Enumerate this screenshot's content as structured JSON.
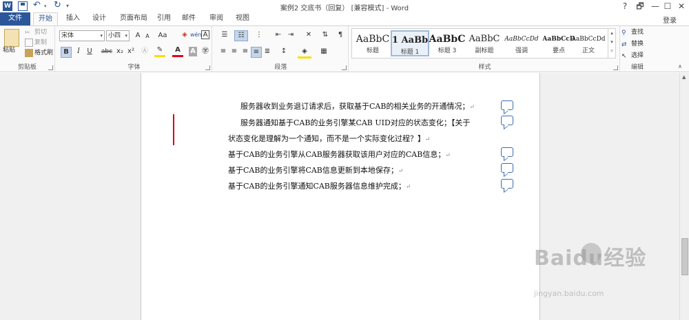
{
  "window": {
    "title": "案例2 交底书（回复） [兼容模式] - Word",
    "login": "登录",
    "logo": "W",
    "help": "?",
    "controls": [
      "🗗",
      "—",
      "☐",
      "✕"
    ]
  },
  "tabs": {
    "file": "文件",
    "items": [
      "开始",
      "插入",
      "设计",
      "页面布局",
      "引用",
      "邮件",
      "审阅",
      "视图"
    ],
    "active": "开始"
  },
  "ribbon": {
    "clipboard": {
      "label": "剪贴板",
      "paste": "粘贴",
      "cut": "剪切",
      "copy": "复制",
      "format_painter": "格式刷"
    },
    "font": {
      "label": "字体",
      "font_name": "宋体",
      "font_size": "小四",
      "grow": "A",
      "shrink": "A",
      "case": "Aa",
      "bold": "B",
      "italic": "I",
      "underline": "U",
      "strike": "abc",
      "sub": "x₂",
      "sup": "x²"
    },
    "paragraph": {
      "label": "段落"
    },
    "styles": {
      "label": "样式",
      "items": [
        {
          "sample": "AaBbC",
          "name": "标题"
        },
        {
          "sample": "1 AaBb",
          "name": "标题 1"
        },
        {
          "sample": "AaBbC",
          "name": "标题 3"
        },
        {
          "sample": "AaBbC",
          "name": "副标题"
        },
        {
          "sample": "AaBbCcDd",
          "name": "强调"
        },
        {
          "sample": "AaBbCcD",
          "name": "要点"
        },
        {
          "sample": "AaBbCcDd",
          "name": "正文"
        }
      ],
      "selected": "标题 1"
    },
    "editing": {
      "label": "编辑",
      "find": "查找",
      "replace": "替换",
      "select": "选择"
    }
  },
  "document": {
    "paragraphs": [
      {
        "text": "服务器收到业务退订请求后，获取基于CAB的相关业务的开通情况；",
        "comment": true
      },
      {
        "text": "服务器通知基于CAB的业务引擎某CAB UID对应的状态变化；【关于",
        "comment": true
      },
      {
        "text": "状态变化是理解为一个通知，而不是一个实际变化过程？】",
        "comment": false
      },
      {
        "text": "基于CAB的业务引擎从CAB服务器获取该用户对应的CAB信息；",
        "comment": true
      },
      {
        "text": "基于CAB的业务引擎将CAB信息更新到本地保存；",
        "comment": true
      },
      {
        "text": "基于CAB的业务引擎通知CAB服务器信息维护完成；",
        "comment": true
      }
    ]
  },
  "watermark": {
    "brand": "Baidu经验",
    "url": "jingyan.baidu.com"
  }
}
